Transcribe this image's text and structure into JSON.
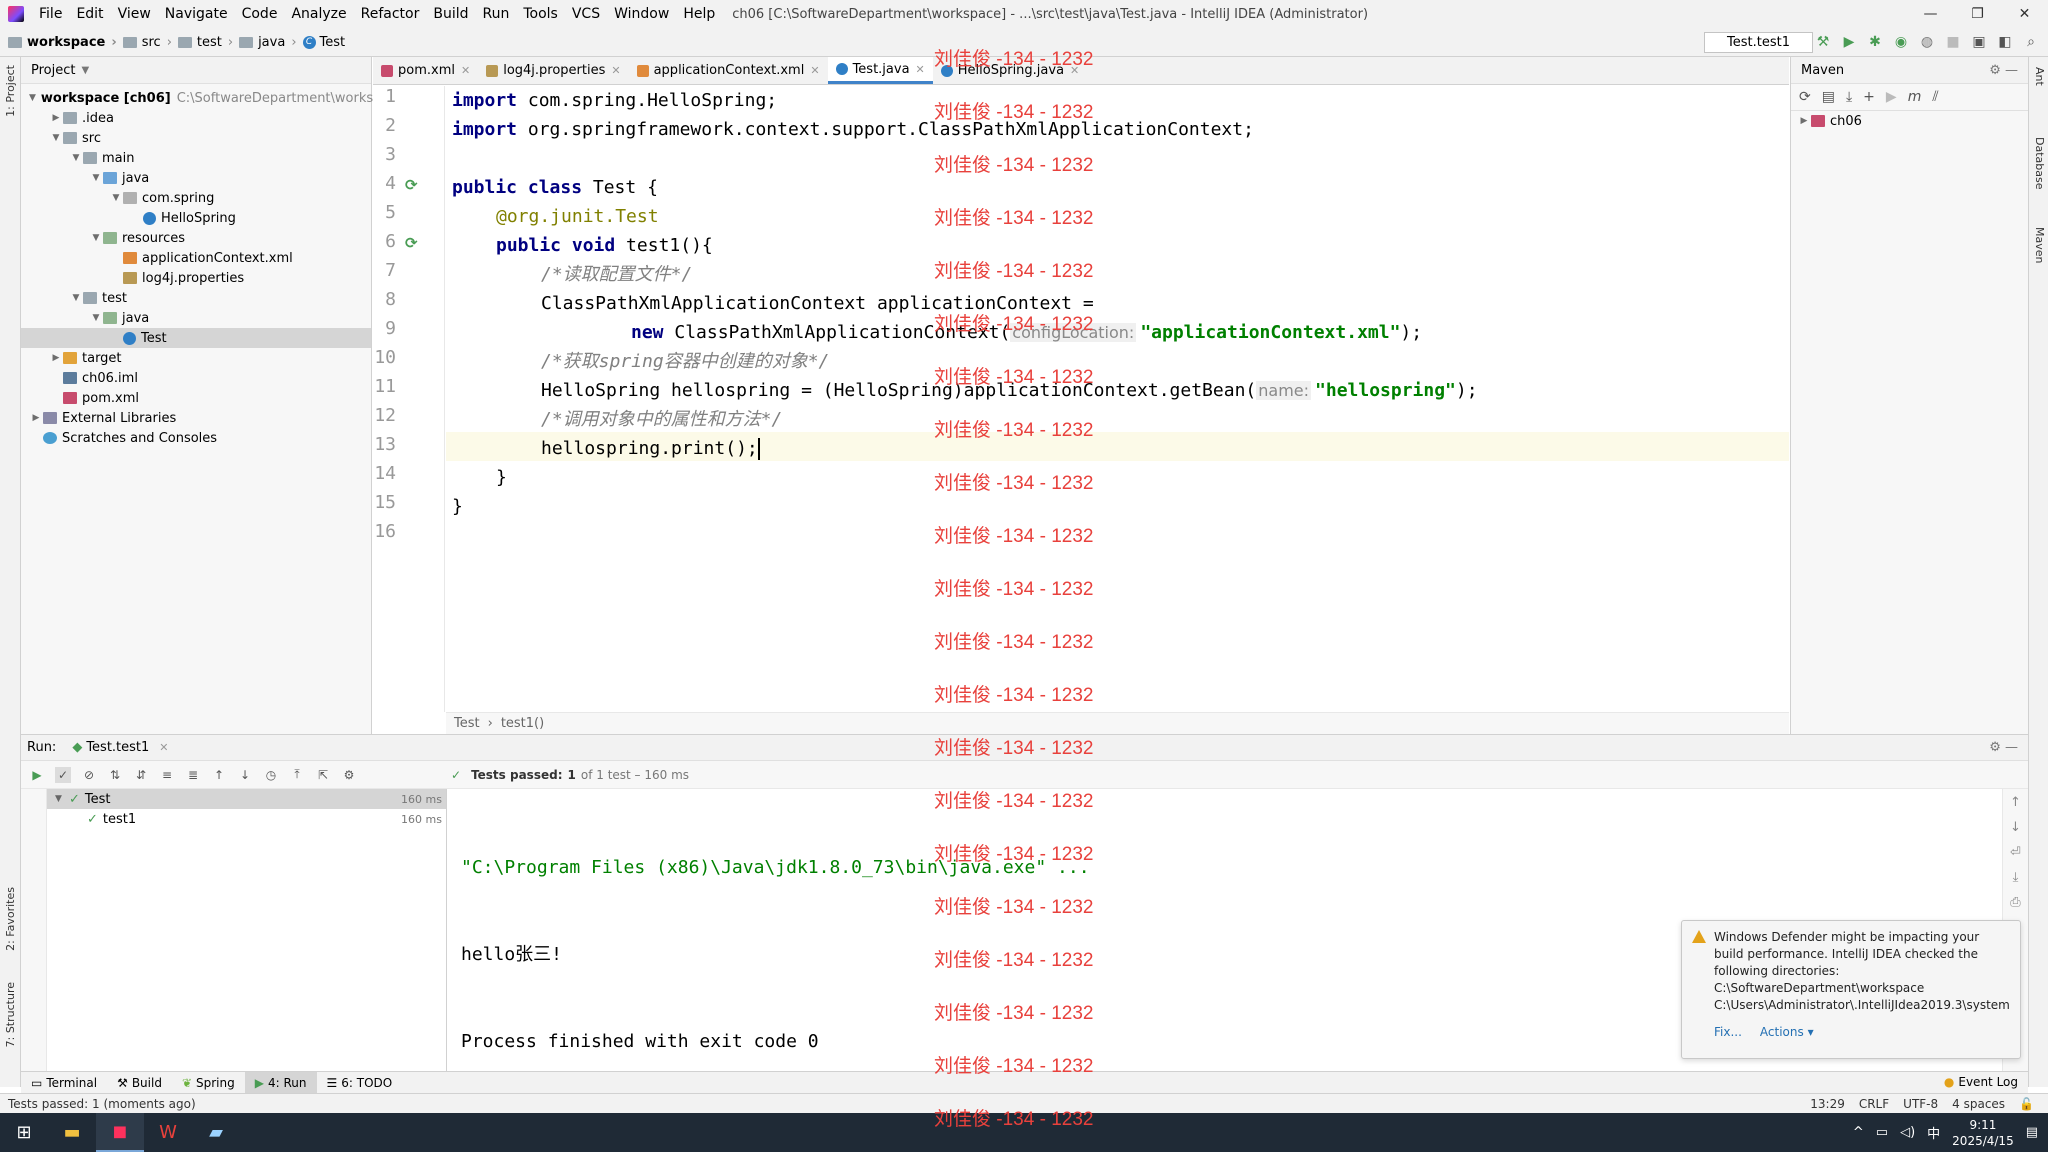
{
  "menu": {
    "items": [
      "File",
      "Edit",
      "View",
      "Navigate",
      "Code",
      "Analyze",
      "Refactor",
      "Build",
      "Run",
      "Tools",
      "VCS",
      "Window",
      "Help"
    ],
    "window_title": "ch06 [C:\\SoftwareDepartment\\workspace] - ...\\src\\test\\java\\Test.java - IntelliJ IDEA (Administrator)"
  },
  "window_controls": {
    "minimize": "—",
    "restore": "❐",
    "close": "✕"
  },
  "breadcrumbs": [
    "workspace",
    "src",
    "test",
    "java",
    "Test"
  ],
  "run_config": {
    "label": "Test.test1"
  },
  "project_panel": {
    "title": "Project",
    "tree": [
      {
        "label": "workspace [ch06]",
        "path": "C:\\SoftwareDepartment\\workspace"
      },
      {
        "label": ".idea"
      },
      {
        "label": "src"
      },
      {
        "label": "main"
      },
      {
        "label": "java"
      },
      {
        "label": "com.spring"
      },
      {
        "label": "HelloSpring"
      },
      {
        "label": "resources"
      },
      {
        "label": "applicationContext.xml"
      },
      {
        "label": "log4j.properties"
      },
      {
        "label": "test"
      },
      {
        "label": "java"
      },
      {
        "label": "Test"
      },
      {
        "label": "target"
      },
      {
        "label": "ch06.iml"
      },
      {
        "label": "pom.xml"
      },
      {
        "label": "External Libraries"
      },
      {
        "label": "Scratches and Consoles"
      }
    ]
  },
  "editor_tabs": [
    "pom.xml",
    "log4j.properties",
    "applicationContext.xml",
    "Test.java",
    "HelloSpring.java"
  ],
  "editor": {
    "line_numbers": [
      "1",
      "2",
      "3",
      "4",
      "5",
      "6",
      "7",
      "8",
      "9",
      "10",
      "11",
      "12",
      "13",
      "14",
      "15",
      "16"
    ],
    "code": {
      "l1_kw": "import",
      "l1_rest": " com.spring.HelloSpring;",
      "l2_kw": "import",
      "l2_rest": " org.springframework.context.support.ClassPathXmlApplicationContext;",
      "l4_kw": "public class",
      "l4_rest": " Test {",
      "l5_ann": "@org.junit.",
      "l5_ann2": "Test",
      "l6_kw": "public void",
      "l6_rest": " test1(){",
      "l7_cm": "/*读取配置文件*/",
      "l8": "ClassPathXmlApplicationContext applicationContext =",
      "l9_kw": "new",
      "l9_rest": " ClassPathXmlApplicationContext(",
      "l9_hint": "configLocation:",
      "l9_str": "\"applicationContext.xml\"",
      "l9_end": ");",
      "l10_cm": "/*获取spring容器中创建的对象*/",
      "l11": "HelloSpring hellospring = (HelloSpring)applicationContext.getBean(",
      "l11_hint": "name:",
      "l11_str": "\"hellospring\"",
      "l11_end": ");",
      "l12_cm": "/*调用对象中的属性和方法*/",
      "l13": "hellospring.print();",
      "l14": "}",
      "l15": "}"
    },
    "crumbs": [
      "Test",
      "test1()"
    ]
  },
  "maven": {
    "title": "Maven",
    "root": "ch06"
  },
  "run_panel": {
    "label": "Run:",
    "tab": "Test.test1",
    "status_prefix": "Tests passed:",
    "status_count": "1",
    "status_suffix": "of 1 test – 160 ms",
    "tree": [
      {
        "label": "Test",
        "time": "160 ms"
      },
      {
        "label": "test1",
        "time": "160 ms"
      }
    ],
    "console": [
      "\"C:\\Program Files (x86)\\Java\\jdk1.8.0_73\\bin\\java.exe\" ...",
      "hello张三!",
      "Process finished with exit code 0"
    ]
  },
  "notification": {
    "text": "Windows Defender might be impacting your build performance. IntelliJ IDEA checked the following directories:",
    "dir1": "C:\\SoftwareDepartment\\workspace",
    "dir2": "C:\\Users\\Administrator\\.IntelliJIdea2019.3\\system",
    "fix": "Fix...",
    "actions": "Actions ▾"
  },
  "bottom_tabs": [
    "Terminal",
    "Build",
    "Spring",
    "4: Run",
    "6: TODO"
  ],
  "event_log": "Event Log",
  "statusbar": {
    "left": "Tests passed: 1 (moments ago)",
    "pos": "13:29",
    "crlf": "CRLF",
    "enc": "UTF-8",
    "indent": "4 spaces"
  },
  "side_labels": {
    "project": "1: Project",
    "favorites": "2: Favorites",
    "structure": "7: Structure",
    "ant": "Ant",
    "database": "Database",
    "maven": "Maven"
  },
  "taskbar": {
    "time": "9:11",
    "date": "2025/4/15",
    "ime": "中"
  },
  "watermark": "刘佳俊 -134 - 1232",
  "colors": {
    "accent": "#4083c9",
    "keyword": "#000080",
    "string": "#008000",
    "comment": "#808080",
    "watermark": "#e8413c"
  }
}
